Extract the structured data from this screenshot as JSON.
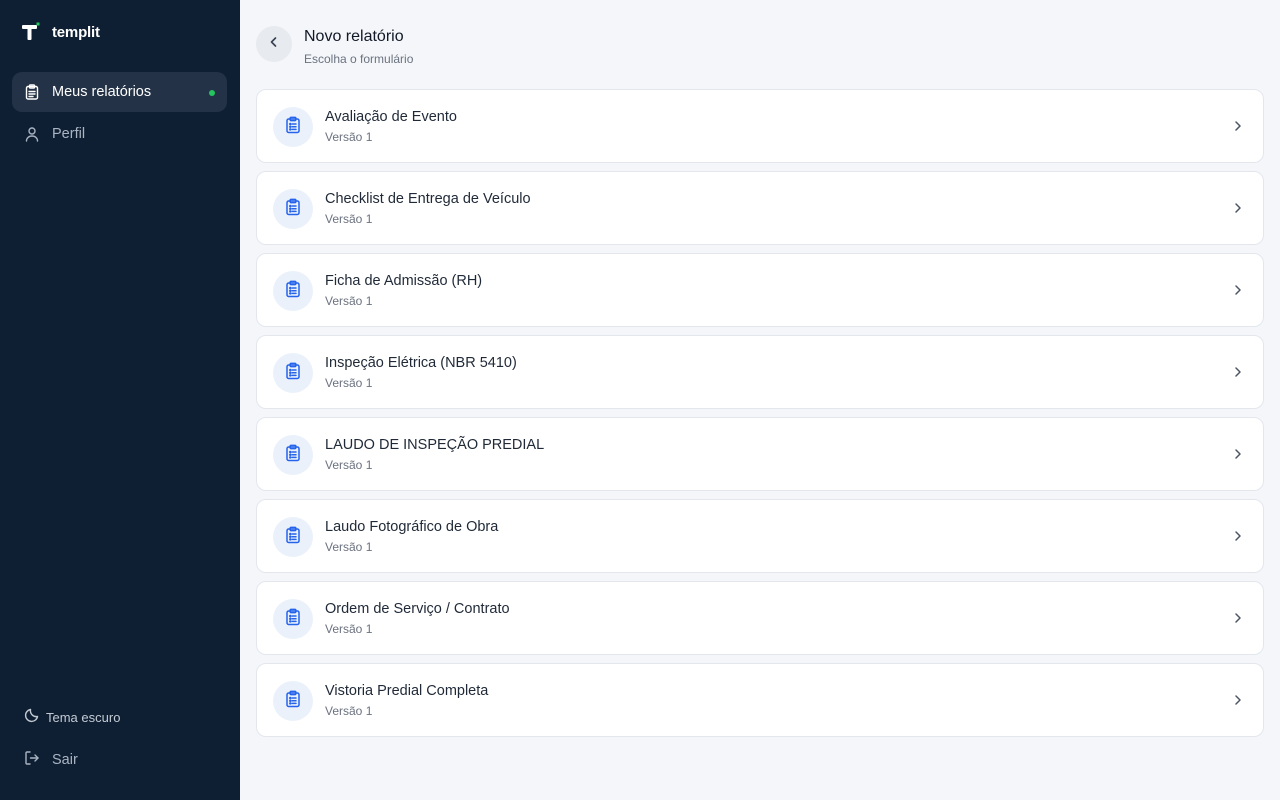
{
  "sidebar": {
    "brand_name": "templit",
    "nav": [
      {
        "label": "Meus relatórios",
        "icon": "clipboard-icon",
        "active": true,
        "indicator_color": "#22c55e"
      },
      {
        "label": "Perfil",
        "icon": "user-icon",
        "active": false
      }
    ],
    "theme_toggle_label": "Tema escuro",
    "logout_label": "Sair"
  },
  "header": {
    "title": "Novo relatório",
    "subtitle": "Escolha o formulário"
  },
  "forms": [
    {
      "title": "Avaliação de Evento",
      "version": "Versão 1"
    },
    {
      "title": "Checklist de Entrega de Veículo",
      "version": "Versão 1"
    },
    {
      "title": "Ficha de Admissão (RH)",
      "version": "Versão 1"
    },
    {
      "title": "Inspeção Elétrica (NBR 5410)",
      "version": "Versão 1"
    },
    {
      "title": "LAUDO DE INSPEÇÃO PREDIAL",
      "version": "Versão 1"
    },
    {
      "title": "Laudo Fotográfico de Obra",
      "version": "Versão 1"
    },
    {
      "title": "Ordem de Serviço / Contrato",
      "version": "Versão 1"
    },
    {
      "title": "Vistoria Predial Completa",
      "version": "Versão 1"
    }
  ],
  "colors": {
    "sidebar_bg": "#0f1f33",
    "accent_blue": "#2563eb",
    "active_dot": "#22c55e"
  }
}
